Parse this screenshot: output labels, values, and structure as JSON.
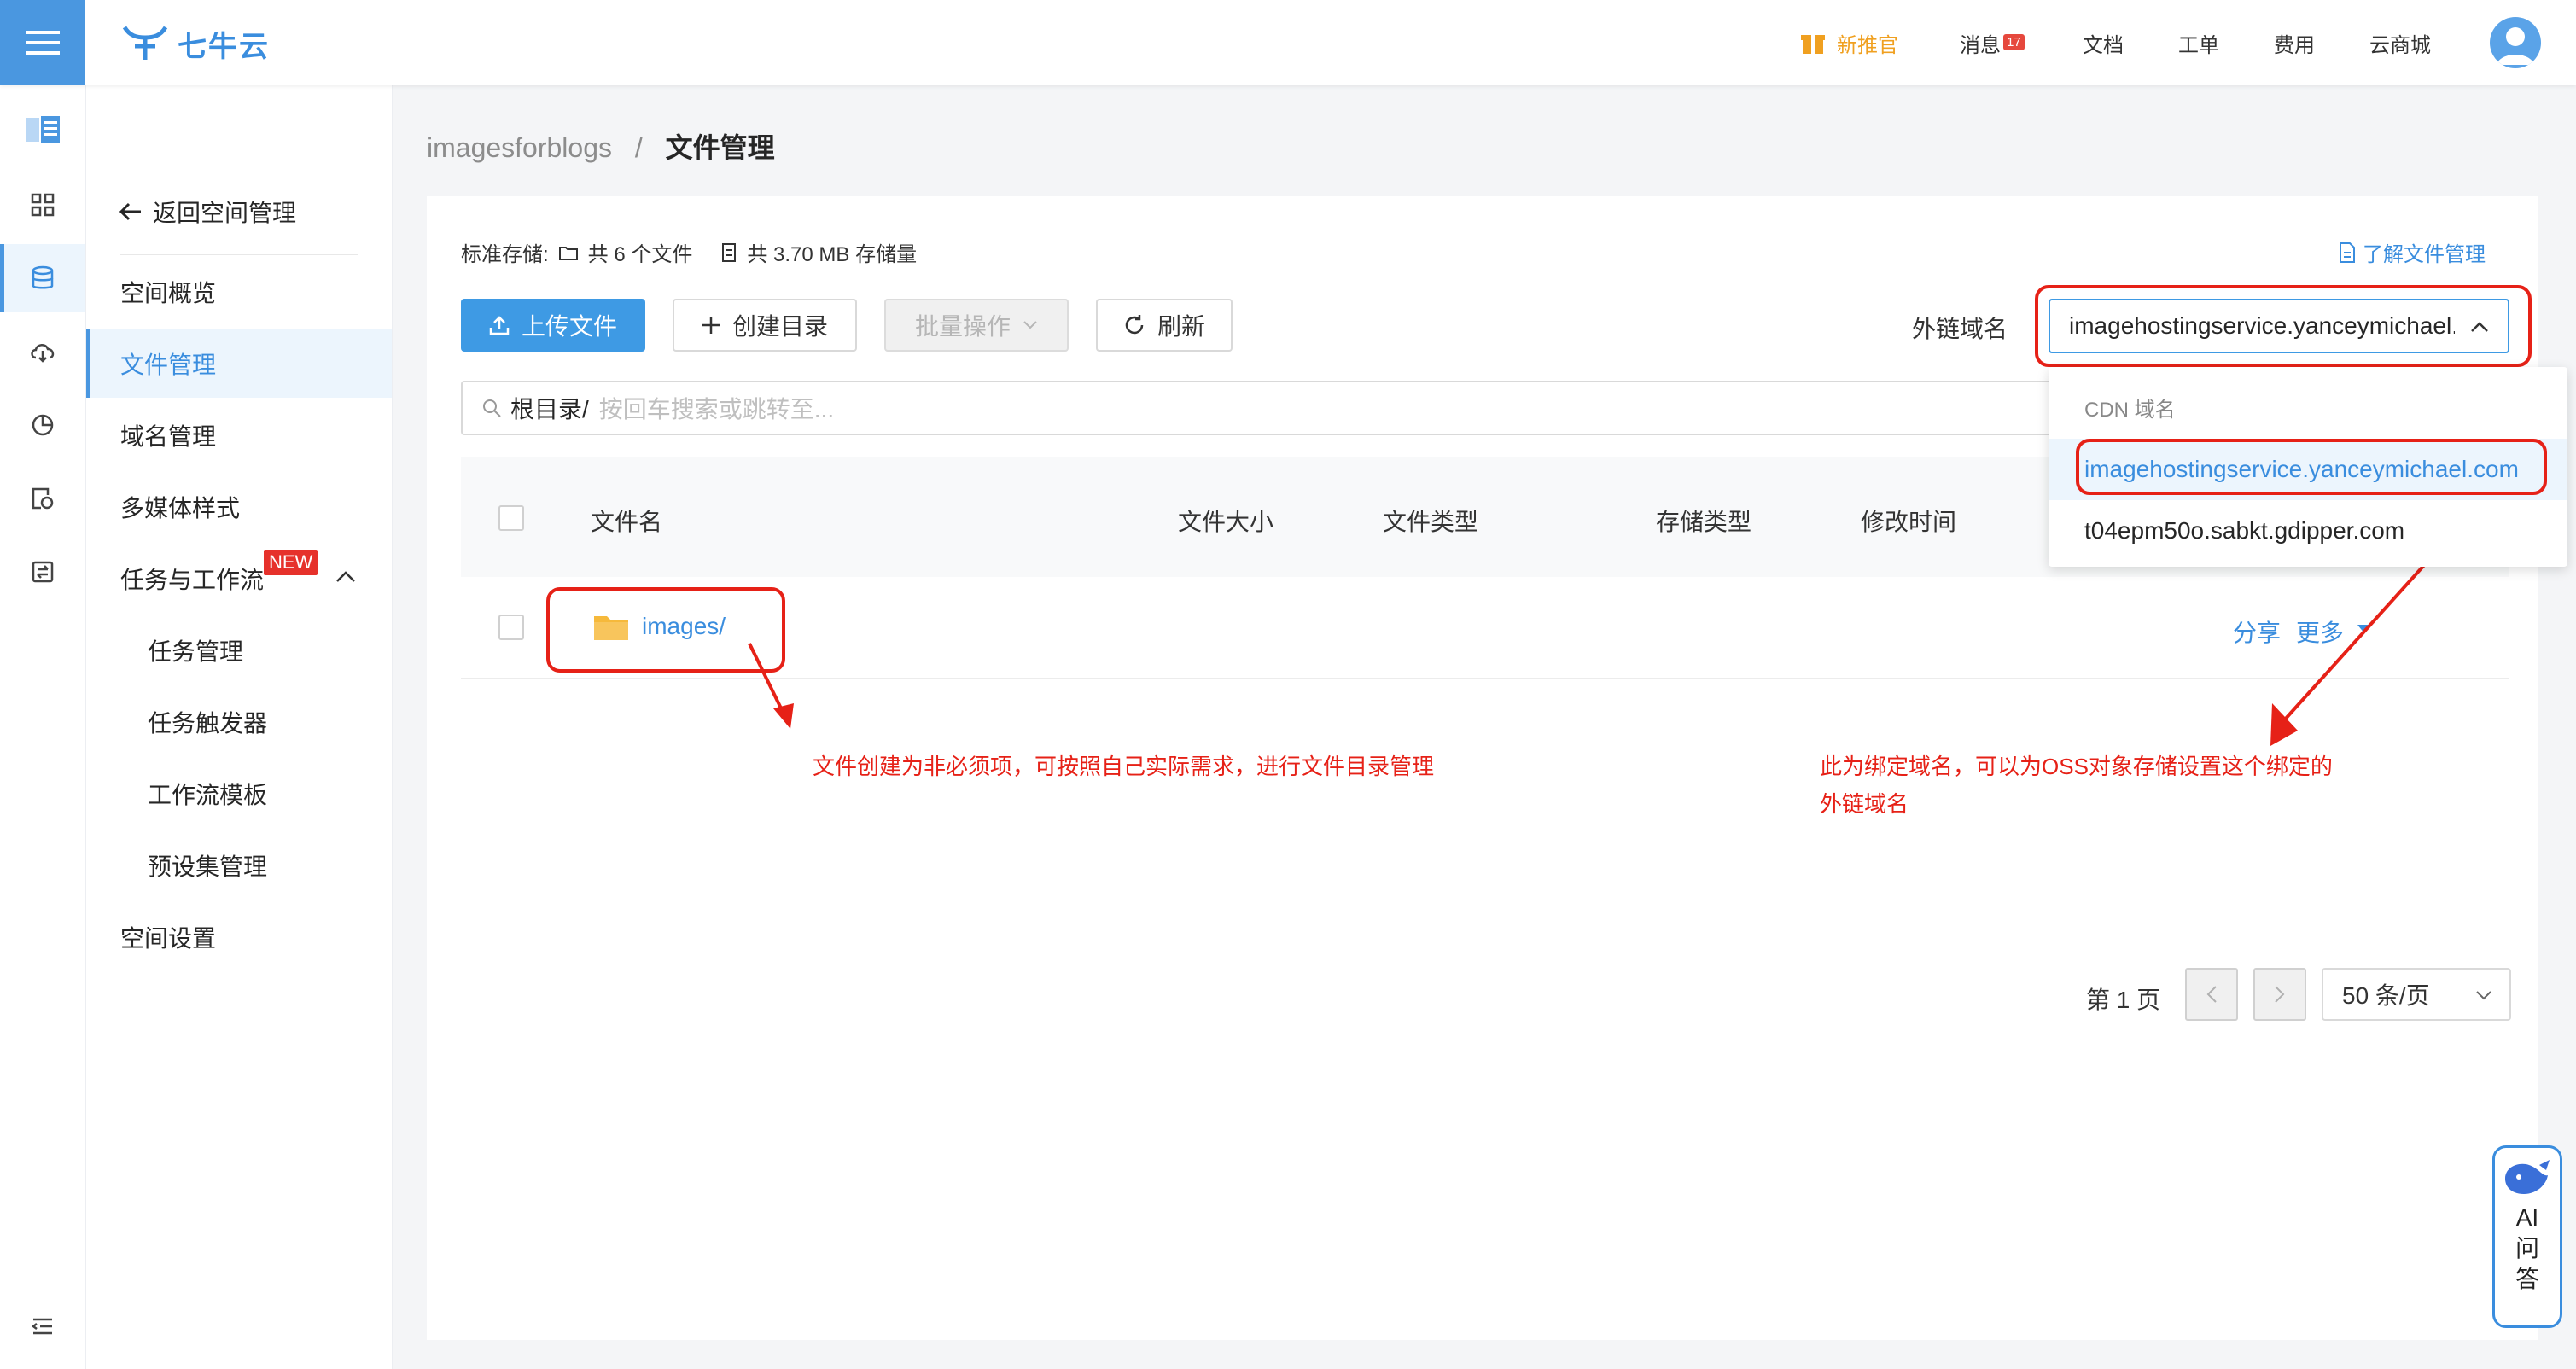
{
  "header": {
    "brand": "七牛云",
    "nav": [
      {
        "label": "新推官",
        "highlight": true
      },
      {
        "label": "消息",
        "badge": "17"
      },
      {
        "label": "文档"
      },
      {
        "label": "工单"
      },
      {
        "label": "费用"
      },
      {
        "label": "云商城"
      }
    ]
  },
  "sidebar": {
    "back_label": "返回空间管理",
    "items": [
      {
        "label": "空间概览"
      },
      {
        "label": "文件管理",
        "active": true
      },
      {
        "label": "域名管理"
      },
      {
        "label": "多媒体样式"
      },
      {
        "label": "任务与工作流",
        "tag": "NEW"
      },
      {
        "label": "任务管理"
      },
      {
        "label": "任务触发器"
      },
      {
        "label": "工作流模板"
      },
      {
        "label": "预设集管理"
      },
      {
        "label": "空间设置"
      }
    ]
  },
  "breadcrumb": {
    "bucket": "imagesforblogs",
    "separator": "/",
    "current": "文件管理"
  },
  "stats": {
    "storage_label": "标准存储:",
    "files": "共 6 个文件",
    "size": "共 3.70 MB 存储量"
  },
  "learn_link": "了解文件管理",
  "toolbar": {
    "upload": "上传文件",
    "create_dir": "创建目录",
    "batch": "批量操作",
    "refresh": "刷新",
    "domain_label": "外链域名",
    "domain_value": "imagehostingservice.yanceymichael.com"
  },
  "search": {
    "prefix": "根目录/",
    "placeholder": "按回车搜索或跳转至..."
  },
  "table": {
    "columns": [
      "文件名",
      "文件大小",
      "文件类型",
      "存储类型",
      "修改时间"
    ],
    "rows": [
      {
        "name": "images/",
        "actions": [
          "分享",
          "更多"
        ]
      }
    ]
  },
  "dropdown": {
    "group": "CDN 域名",
    "options": [
      "imagehostingservice.yanceymichael.com",
      "t04epm50o.sabkt.gdipper.com"
    ],
    "selected_index": 0
  },
  "annotations": {
    "left": "文件创建为非必须项，可按照自己实际需求，进行文件目录管理",
    "right_line1": "此为绑定域名，可以为OSS对象存储设置这个绑定的",
    "right_line2": "外链域名"
  },
  "pagination": {
    "page_label": "第 1 页",
    "page_size": "50 条/页"
  },
  "ai_widget": {
    "line1": "AI",
    "line2": "问",
    "line3": "答"
  },
  "colors": {
    "primary": "#3e9ae4",
    "annotation": "#e62117",
    "promo": "#f0a020"
  }
}
